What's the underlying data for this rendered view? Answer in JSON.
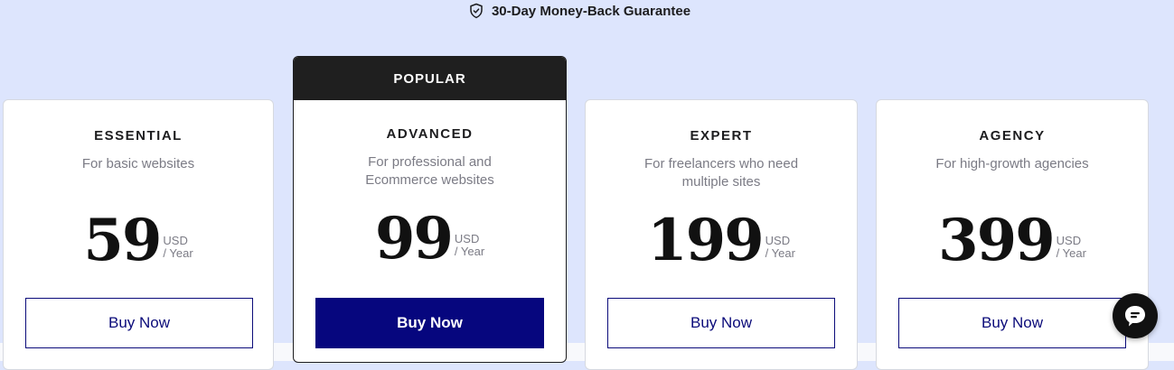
{
  "guarantee": {
    "text": "30-Day Money-Back Guarantee",
    "icon": "shield-check-icon"
  },
  "plans": [
    {
      "name": "ESSENTIAL",
      "desc": "For basic websites",
      "price": "59",
      "currency": "USD",
      "period": "/ Year",
      "button": "Buy Now",
      "popular": false
    },
    {
      "name": "ADVANCED",
      "desc": "For professional and Ecommerce websites",
      "price": "99",
      "currency": "USD",
      "period": "/ Year",
      "button": "Buy Now",
      "popular": true,
      "badge": "POPULAR"
    },
    {
      "name": "EXPERT",
      "desc": "For freelancers who need multiple sites",
      "price": "199",
      "currency": "USD",
      "period": "/ Year",
      "button": "Buy Now",
      "popular": false
    },
    {
      "name": "AGENCY",
      "desc": "For high-growth agencies",
      "price": "399",
      "currency": "USD",
      "period": "/ Year",
      "button": "Buy Now",
      "popular": false
    }
  ],
  "chat": {
    "icon": "chat-bubble-icon"
  },
  "colors": {
    "background": "#dde5fd",
    "primary": "#06067e",
    "dark": "#1f1f1f"
  }
}
